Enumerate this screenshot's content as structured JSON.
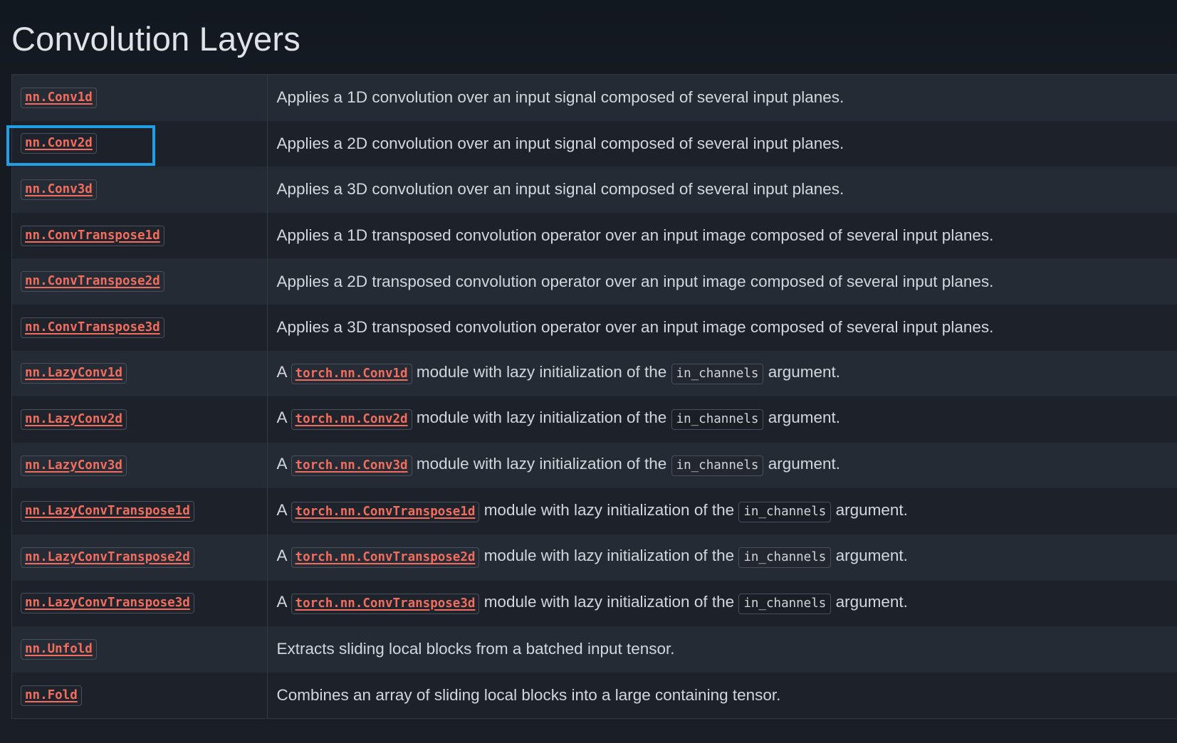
{
  "page": {
    "title": "Convolution Layers"
  },
  "rows": [
    {
      "name": "nn.Conv1d",
      "type": "text",
      "desc": "Applies a 1D convolution over an input signal composed of several input planes."
    },
    {
      "name": "nn.Conv2d",
      "type": "text",
      "desc": "Applies a 2D convolution over an input signal composed of several input planes."
    },
    {
      "name": "nn.Conv3d",
      "type": "text",
      "desc": "Applies a 3D convolution over an input signal composed of several input planes."
    },
    {
      "name": "nn.ConvTranspose1d",
      "type": "text",
      "desc": "Applies a 1D transposed convolution operator over an input image composed of several input planes."
    },
    {
      "name": "nn.ConvTranspose2d",
      "type": "text",
      "desc": "Applies a 2D transposed convolution operator over an input image composed of several input planes."
    },
    {
      "name": "nn.ConvTranspose3d",
      "type": "text",
      "desc": "Applies a 3D transposed convolution operator over an input image composed of several input planes."
    },
    {
      "name": "nn.LazyConv1d",
      "type": "lazy",
      "prefix": "A",
      "link": "torch.nn.Conv1d",
      "middle": "module with lazy initialization of the",
      "code": "in_channels",
      "suffix": "argument."
    },
    {
      "name": "nn.LazyConv2d",
      "type": "lazy",
      "prefix": "A",
      "link": "torch.nn.Conv2d",
      "middle": "module with lazy initialization of the",
      "code": "in_channels",
      "suffix": "argument."
    },
    {
      "name": "nn.LazyConv3d",
      "type": "lazy",
      "prefix": "A",
      "link": "torch.nn.Conv3d",
      "middle": "module with lazy initialization of the",
      "code": "in_channels",
      "suffix": "argument."
    },
    {
      "name": "nn.LazyConvTranspose1d",
      "type": "lazy",
      "prefix": "A",
      "link": "torch.nn.ConvTranspose1d",
      "middle": "module with lazy initialization of the",
      "code": "in_channels",
      "suffix": "argument."
    },
    {
      "name": "nn.LazyConvTranspose2d",
      "type": "lazy",
      "prefix": "A",
      "link": "torch.nn.ConvTranspose2d",
      "middle": "module with lazy initialization of the",
      "code": "in_channels",
      "suffix": "argument."
    },
    {
      "name": "nn.LazyConvTranspose3d",
      "type": "lazy",
      "prefix": "A",
      "link": "torch.nn.ConvTranspose3d",
      "middle": "module with lazy initialization of the",
      "code": "in_channels",
      "suffix": "argument."
    },
    {
      "name": "nn.Unfold",
      "type": "text",
      "desc": "Extracts sliding local blocks from a batched input tensor."
    },
    {
      "name": "nn.Fold",
      "type": "text",
      "desc": "Combines an array of sliding local blocks into a large containing tensor."
    }
  ],
  "highlight": {
    "target": "nn.Conv2d",
    "color": "#1ea0e6"
  },
  "colors": {
    "link": "#f26d5e",
    "background": "#151a21",
    "row_odd": "#252b35",
    "row_even": "#1d222a"
  }
}
